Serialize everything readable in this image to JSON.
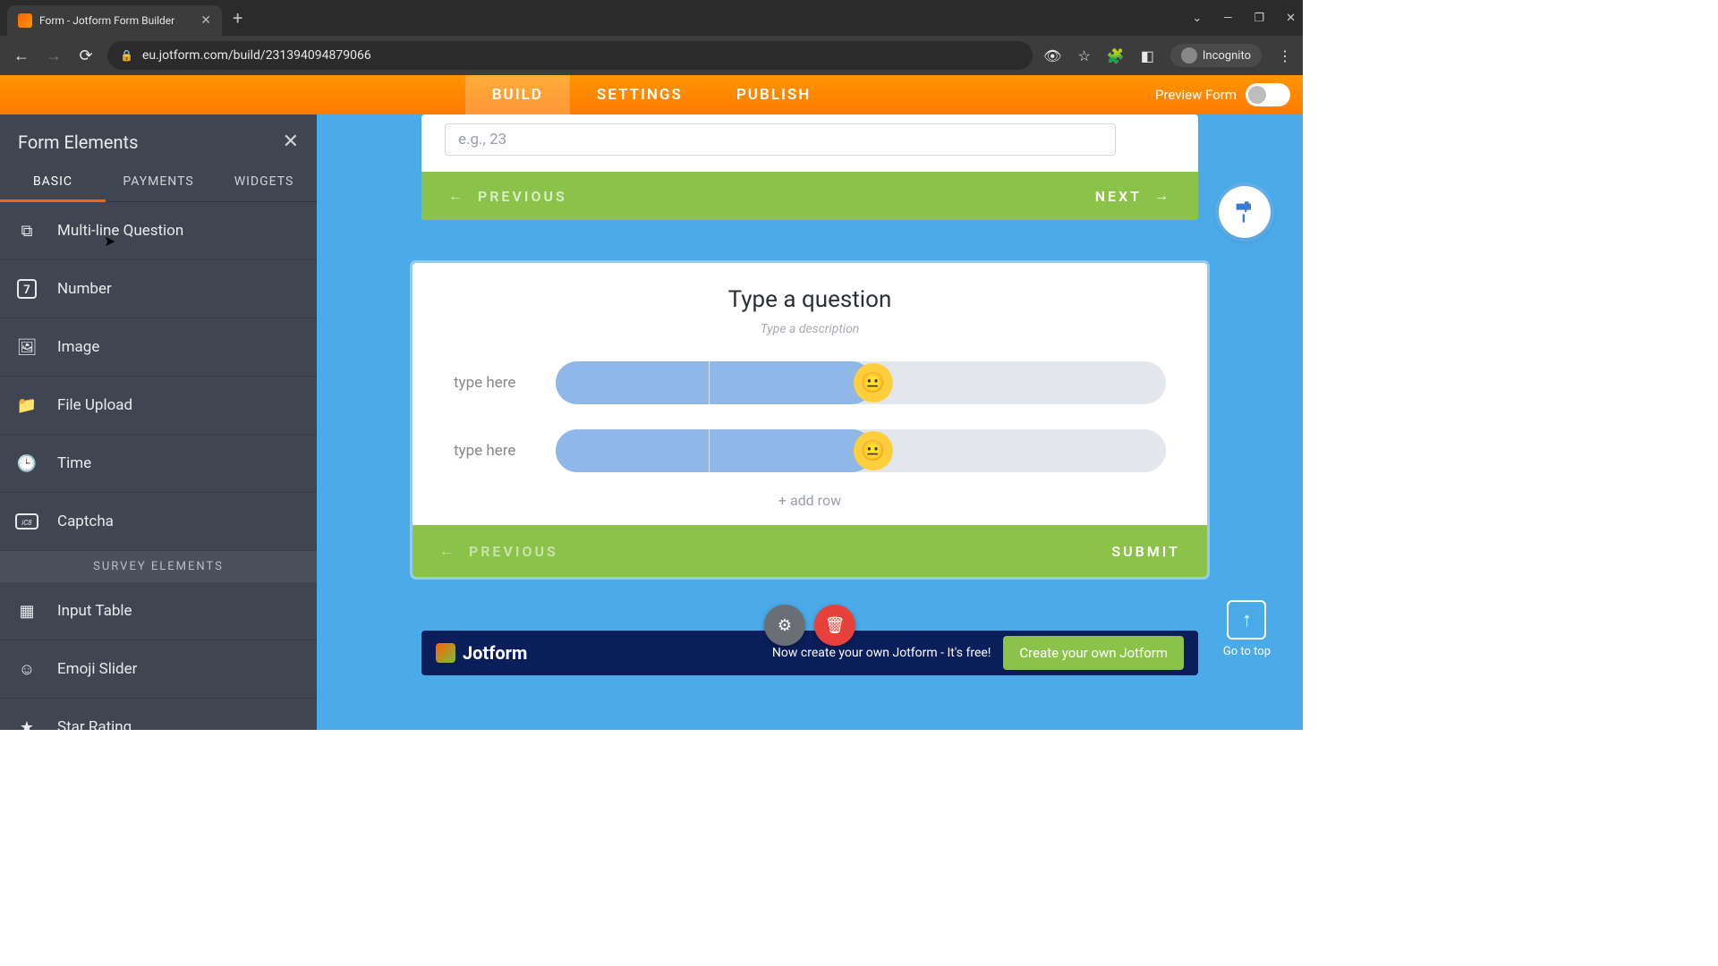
{
  "browser": {
    "tab_title": "Form - Jotform Form Builder",
    "url": "eu.jotform.com/build/231394094879066",
    "incognito_label": "Incognito"
  },
  "header": {
    "tabs": {
      "build": "BUILD",
      "settings": "SETTINGS",
      "publish": "PUBLISH"
    },
    "preview_label": "Preview Form"
  },
  "sidebar": {
    "title": "Form Elements",
    "tabs": {
      "basic": "BASIC",
      "payments": "PAYMENTS",
      "widgets": "WIDGETS"
    },
    "items": [
      {
        "label": "Multi-line Question",
        "icon": "multiline"
      },
      {
        "label": "Number",
        "icon": "number"
      },
      {
        "label": "Image",
        "icon": "image"
      },
      {
        "label": "File Upload",
        "icon": "upload"
      },
      {
        "label": "Time",
        "icon": "time"
      },
      {
        "label": "Captcha",
        "icon": "captcha"
      }
    ],
    "section_header": "SURVEY ELEMENTS",
    "survey_items": [
      {
        "label": "Input Table",
        "icon": "table"
      },
      {
        "label": "Emoji Slider",
        "icon": "emoji"
      },
      {
        "label": "Star Rating",
        "icon": "star"
      }
    ]
  },
  "form": {
    "placeholder_example": "e.g., 23",
    "prev_label": "PREVIOUS",
    "next_label": "NEXT",
    "question_title": "Type a question",
    "question_desc": "Type a description",
    "row_placeholder": "type here",
    "add_row_label": "+ add row",
    "submit_label": "SUBMIT"
  },
  "go_top_label": "Go to top",
  "promo": {
    "brand": "Jotform",
    "text": "Now create your own Jotform - It's free!",
    "cta": "Create your own Jotform"
  }
}
